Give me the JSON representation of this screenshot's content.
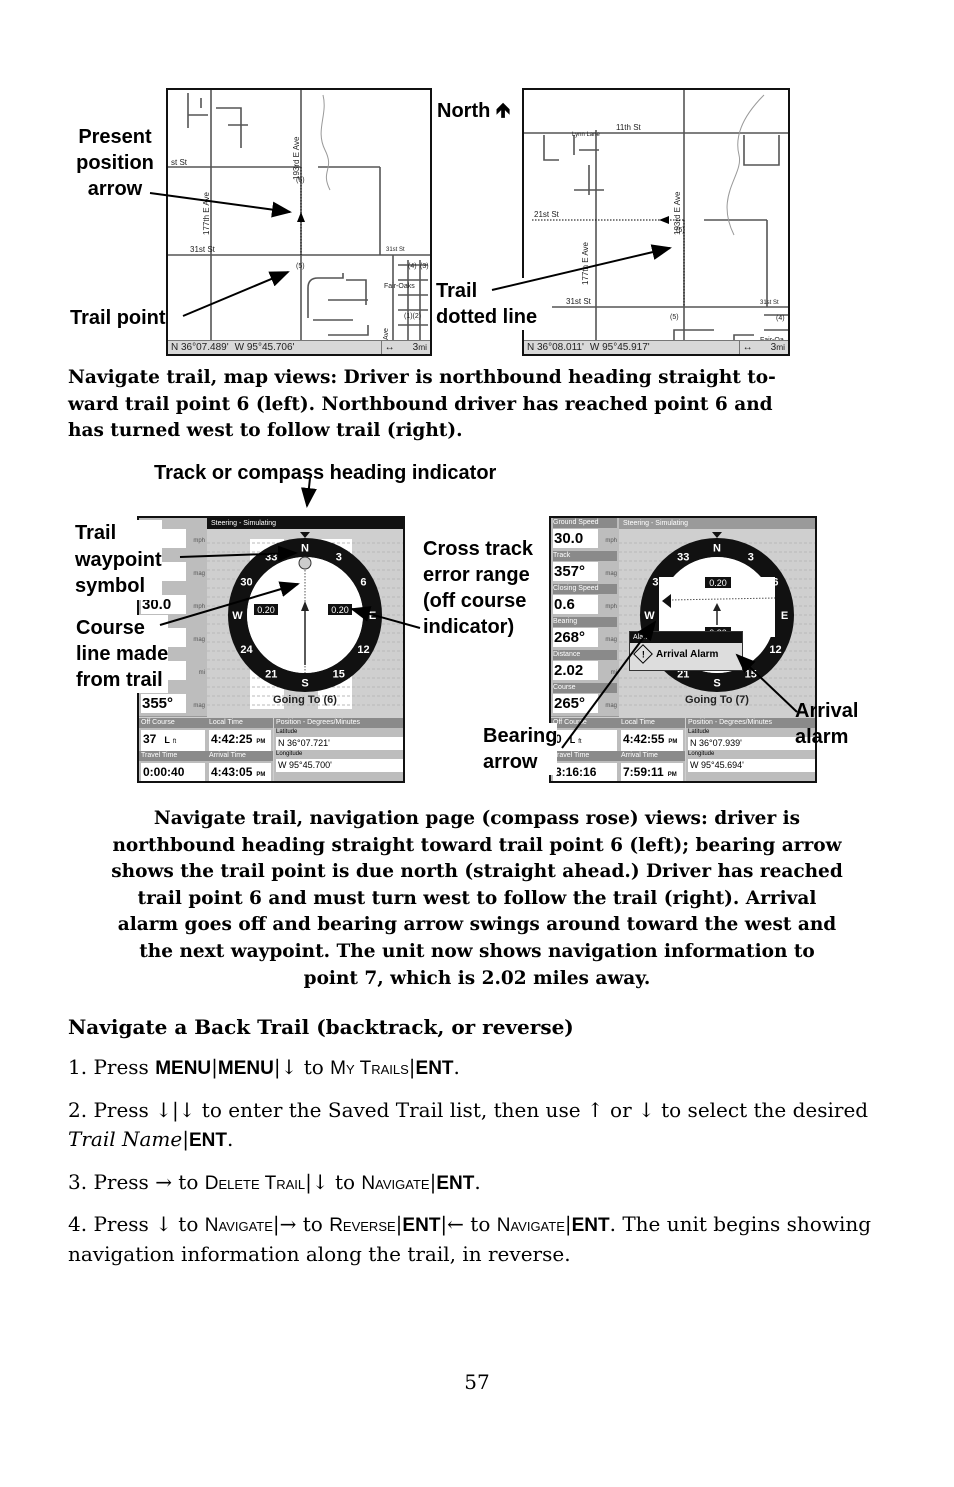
{
  "figure1": {
    "labels": {
      "present_position": [
        "Present",
        "position",
        "arrow"
      ],
      "trail_point": "Trail point",
      "north": "North",
      "north_icon": "arrow-up-icon",
      "trail_dotted": [
        "Trail",
        "dotted line"
      ]
    },
    "left_map": {
      "streets": [
        "st St",
        "31st St",
        "31st St",
        "177th E Ave",
        "193rd E Ave",
        "Fair-Oaks",
        "Ave"
      ],
      "points": [
        "(6)",
        "(5)",
        "(4)",
        "(3)",
        "(1)(2)"
      ],
      "lat": "N  36°07.489'",
      "lon": "W  95°45.706'",
      "scale": "3",
      "scale_unit": "mi"
    },
    "right_map": {
      "streets": [
        "11th St",
        "Lynn Lane",
        "21st St",
        "31st St",
        "31st St",
        "177th E Ave",
        "193rd E Ave",
        "Fair-Oa"
      ],
      "points": [
        "(6)",
        "(5)",
        "(4)"
      ],
      "lat": "N  36°08.011'",
      "lon": "W  95°45.917'",
      "scale": "3",
      "scale_unit": "mi"
    },
    "caption": [
      "Navigate trail, map views: Driver is northbound heading straight to-",
      "ward trail point 6 (left). Northbound driver has reached point 6 and",
      "has turned west to follow trail (right)."
    ]
  },
  "figure2": {
    "labels": {
      "heading_indicator": "Track or compass heading indicator",
      "waypoint_symbol": [
        "Trail",
        "waypoint",
        "symbol"
      ],
      "course_line": [
        "Course",
        "line made",
        "from trail"
      ],
      "cross_track": [
        "Cross track",
        "error range",
        "(off course",
        "indicator)"
      ],
      "bearing_arrow": [
        "Bearing",
        "arrow"
      ],
      "arrival_alarm": [
        "Arrival",
        "alarm"
      ]
    },
    "compass_marks": [
      "N",
      "3",
      "6",
      "E",
      "12",
      "15",
      "S",
      "21",
      "24",
      "W",
      "30",
      "33"
    ],
    "left_nav": {
      "steering": "Steering - Simulating",
      "panels": [
        {
          "label": "",
          "value": "",
          "unit": "mph"
        },
        {
          "label": "",
          "value": "",
          "unit": "mag"
        },
        {
          "label": "",
          "value": "30.0",
          "unit": "mph"
        },
        {
          "label": "",
          "value": "",
          "unit": "mag"
        },
        {
          "label": "",
          "value": "",
          "unit": "mi"
        },
        {
          "label": "",
          "value": "355°",
          "unit": "mag"
        }
      ],
      "xte_left": "0.20",
      "xte_right": "0.20",
      "going_to": "Going To (6)",
      "off_course_label": "Off Course",
      "off_course": "37",
      "off_course_dir": "L",
      "off_course_unit": "ft",
      "local_time_label": "Local Time",
      "local_time": "4:42:25",
      "travel_time_label": "Travel Time",
      "travel_time": "0:00:40",
      "arrival_time_label": "Arrival Time",
      "arrival_time": "4:43:05",
      "ampm": "PM",
      "position_label": "Position - Degrees/Minutes",
      "lat_label": "Latitude",
      "lat": "N   36°07.721'",
      "lon_label": "Longitude",
      "lon": "W   95°45.700'"
    },
    "right_nav": {
      "steering": "Steering - Simulating",
      "panels": [
        {
          "label": "Ground Speed",
          "value": "30.0",
          "unit": "mph"
        },
        {
          "label": "Track",
          "value": "357°",
          "unit": "mag"
        },
        {
          "label": "Closing Speed",
          "value": "0.6",
          "unit": "mph"
        },
        {
          "label": "Bearing",
          "value": "268°",
          "unit": "mag"
        },
        {
          "label": "Distance",
          "value": "2.02",
          "unit": "mi"
        },
        {
          "label": "Course",
          "value": "265°",
          "unit": "mag"
        }
      ],
      "xte_top": "0.20",
      "xte_bottom": "0.20",
      "alarm_title": "Alarm",
      "alarm_text": "Arrival Alarm",
      "going_to": "Going To (7)",
      "off_course_label": "Off Course",
      "off_course": "0",
      "off_course_dir": "L",
      "off_course_unit": "ft",
      "local_time_label": "Local Time",
      "local_time": "4:42:55",
      "travel_time_label": "Travel Time",
      "travel_time": "3:16:16",
      "arrival_time_label": "Arrival Time",
      "arrival_time": "7:59:11",
      "ampm": "PM",
      "position_label": "Position - Degrees/Minutes",
      "lat_label": "Latitude",
      "lat": "N   36°07.939'",
      "lon_label": "Longitude",
      "lon": "W   95°45.694'"
    },
    "caption": [
      "Navigate trail, navigation page (compass rose) views: driver is",
      "northbound heading straight toward trail point 6 (left); bearing arrow",
      "shows the trail point is due north (straight ahead.) Driver has reached",
      "trail point 6 and must turn west to follow the trail (right). Arrival",
      "alarm goes off and bearing arrow swings around toward the west and",
      "the next waypoint. The unit now shows navigation information to",
      "point 7, which is 2.02 miles away."
    ]
  },
  "section": {
    "heading": "Navigate a Back Trail (backtrack, or reverse)",
    "steps": [
      [
        [
          "p",
          "1. Press "
        ],
        [
          "k",
          "MENU"
        ],
        [
          "p",
          "|"
        ],
        [
          "k",
          "MENU"
        ],
        [
          "p",
          "|"
        ],
        [
          "p",
          "↓"
        ],
        [
          "p",
          " to "
        ],
        [
          "s",
          "My Trails"
        ],
        [
          "p",
          "|"
        ],
        [
          "k",
          "ENT"
        ],
        [
          "p",
          "."
        ]
      ],
      [
        [
          "p",
          "2. Press "
        ],
        [
          "p",
          "↓|↓"
        ],
        [
          "p",
          " to enter the Saved Trail list, then use "
        ],
        [
          "p",
          "↑"
        ],
        [
          "p",
          " or "
        ],
        [
          "p",
          "↓"
        ],
        [
          "p",
          " to select the desired "
        ],
        [
          "i",
          "Trail Name"
        ],
        [
          "p",
          "|"
        ],
        [
          "k",
          "ENT"
        ],
        [
          "p",
          "."
        ]
      ],
      [
        [
          "p",
          "3. Press "
        ],
        [
          "p",
          "→"
        ],
        [
          "p",
          " to "
        ],
        [
          "s",
          "Delete Trail"
        ],
        [
          "p",
          "|"
        ],
        [
          "p",
          "↓"
        ],
        [
          "p",
          " to "
        ],
        [
          "s",
          "Navigate"
        ],
        [
          "p",
          "|"
        ],
        [
          "k",
          "ENT"
        ],
        [
          "p",
          "."
        ]
      ],
      [
        [
          "p",
          "4. Press "
        ],
        [
          "p",
          "↓"
        ],
        [
          "p",
          " to "
        ],
        [
          "s",
          "Navigate"
        ],
        [
          "p",
          "|"
        ],
        [
          "p",
          "→"
        ],
        [
          "p",
          " to "
        ],
        [
          "s",
          "Reverse"
        ],
        [
          "p",
          "|"
        ],
        [
          "k",
          "ENT"
        ],
        [
          "p",
          "|"
        ],
        [
          "p",
          "←"
        ],
        [
          "p",
          " to "
        ],
        [
          "s",
          "Navigate"
        ],
        [
          "p",
          "|"
        ],
        [
          "k",
          "ENT"
        ],
        [
          "p",
          ". The unit begins showing navigation information along the trail, in reverse."
        ]
      ]
    ]
  },
  "page_number": "57"
}
